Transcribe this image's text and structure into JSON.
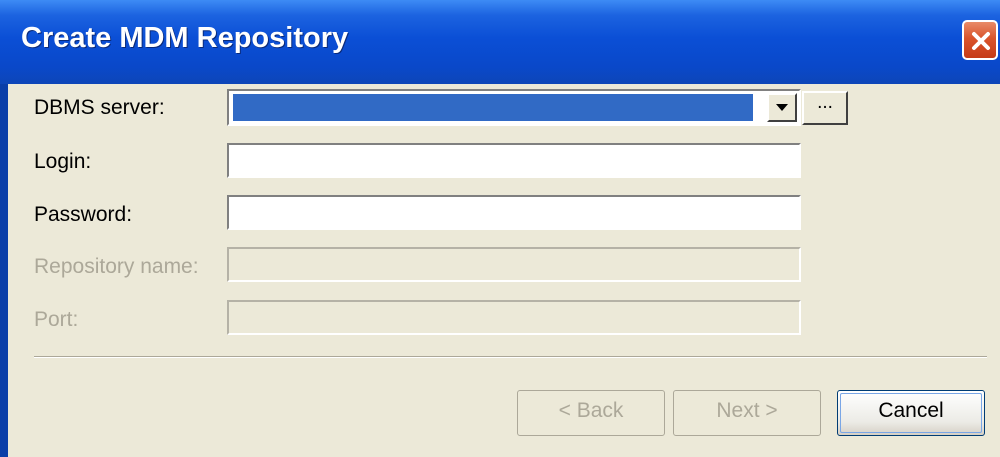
{
  "window": {
    "title": "Create MDM Repository",
    "close_icon": "close-icon"
  },
  "form": {
    "dbms_server": {
      "label": "DBMS server:",
      "value": "",
      "browse_label": "..."
    },
    "login": {
      "label": "Login:",
      "value": ""
    },
    "password": {
      "label": "Password:",
      "value": ""
    },
    "repository_name": {
      "label": "Repository name:",
      "value": "",
      "disabled": true
    },
    "port": {
      "label": "Port:",
      "value": "",
      "disabled": true
    }
  },
  "buttons": {
    "back": {
      "label": "< Back",
      "disabled": true
    },
    "next": {
      "label": "Next >",
      "disabled": true
    },
    "cancel": {
      "label": "Cancel",
      "disabled": false
    }
  },
  "colors": {
    "titlebar": "#0b4fd6",
    "client_bg": "#ece9d8",
    "selection": "#316ac5",
    "close_button": "#d9542c"
  }
}
